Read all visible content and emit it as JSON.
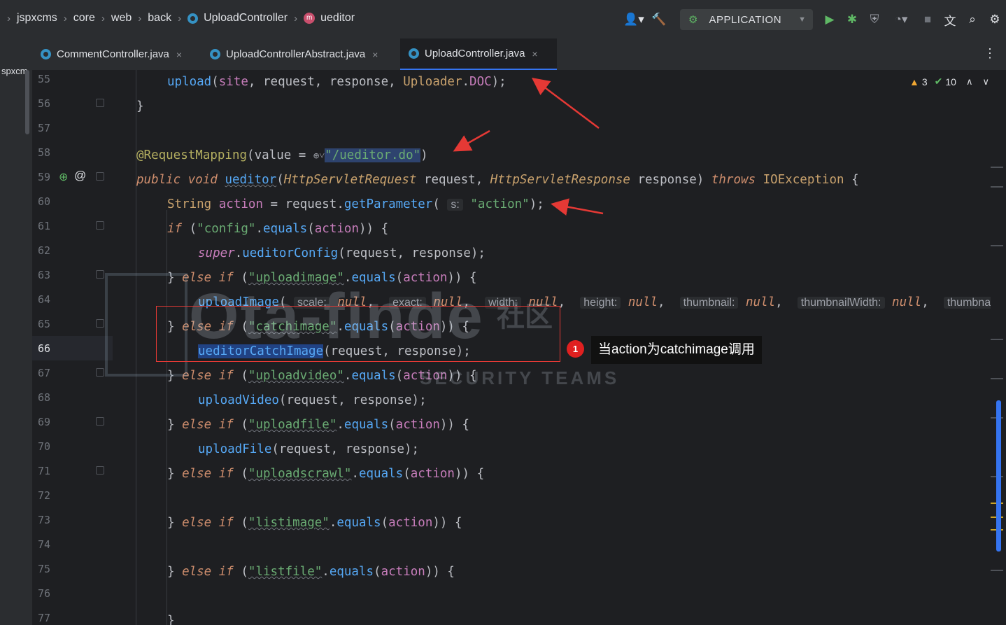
{
  "breadcrumbs": [
    "jspxcms",
    "core",
    "web",
    "back",
    "UploadController",
    "ueditor"
  ],
  "toolbar": {
    "run_config": "APPLICATION"
  },
  "tabs": [
    {
      "label": "CommentController.java",
      "active": false
    },
    {
      "label": "UploadControllerAbstract.java",
      "active": false
    },
    {
      "label": "UploadController.java",
      "active": true
    }
  ],
  "project_label": "spxcm",
  "inspections": {
    "warnings": "3",
    "ok": "10"
  },
  "line_numbers": [
    "55",
    "56",
    "57",
    "58",
    "59",
    "60",
    "61",
    "62",
    "63",
    "64",
    "65",
    "66",
    "67",
    "68",
    "69",
    "70",
    "71",
    "72",
    "73",
    "74",
    "75",
    "76",
    "77"
  ],
  "current_line": "66",
  "code": {
    "l55": {
      "a": "upload",
      "b": "(",
      "c": "site",
      "d": ", request, response, ",
      "e": "Uploader",
      "f": ".",
      "g": "DOC",
      "h": ");"
    },
    "l56": {
      "a": "}"
    },
    "l58": {
      "a": "@RequestMapping",
      "b": "(value = ",
      "c": "\"/ueditor.do\"",
      "d": ")"
    },
    "l59": {
      "a": "public void ",
      "b": "ueditor",
      "c": "(",
      "d": "HttpServletRequest",
      "e": " request, ",
      "f": "HttpServletResponse",
      "g": " response) ",
      "h": "throws ",
      "i": "IOException",
      "j": " {"
    },
    "l60": {
      "a": "String ",
      "b": "action",
      "c": " = request.",
      "d": "getParameter",
      "e": "( ",
      "hint": "s:",
      "f": " \"action\"",
      "g": ");"
    },
    "l61": {
      "a": "if",
      "b": " (",
      "c": "\"config\"",
      "d": ".",
      "e": "equals",
      "f": "(",
      "g": "action",
      "h": ")) {"
    },
    "l62": {
      "a": "super",
      "b": ".",
      "c": "ueditorConfig",
      "d": "(request, response);"
    },
    "l63": {
      "a": "} ",
      "b": "else if",
      "c": " (",
      "d": "\"uploadimage\"",
      "e": ".",
      "f": "equals",
      "g": "(",
      "h": "action",
      "i": ")) {"
    },
    "l64": {
      "a": "uploadImage",
      "b": "( ",
      "h1": "scale:",
      "v1": "null",
      "h2": "exact:",
      "v2": "null",
      "h3": "width:",
      "v3": "null",
      "h4": "height:",
      "v4": "null",
      "h5": "thumbnail:",
      "v5": "null",
      "h6": "thumbnailWidth:",
      "v6": "null",
      "h7": "thumbnailHeig",
      "c": ","
    },
    "l65": {
      "a": "} ",
      "b": "else if",
      "c": " (",
      "d": "\"catchimage\"",
      "e": ".",
      "f": "equals",
      "g": "(",
      "h": "action",
      "i": ")) {"
    },
    "l66": {
      "a": "ueditorCatchImage",
      "b": "(request, response);"
    },
    "l67": {
      "a": "} ",
      "b": "else if",
      "c": " (",
      "d": "\"uploadvideo\"",
      "e": ".",
      "f": "equals",
      "g": "(",
      "h": "action",
      "i": ")) {"
    },
    "l68": {
      "a": "uploadVideo",
      "b": "(request, response);"
    },
    "l69": {
      "a": "} ",
      "b": "else if",
      "c": " (",
      "d": "\"uploadfile\"",
      "e": ".",
      "f": "equals",
      "g": "(",
      "h": "action",
      "i": ")) {"
    },
    "l70": {
      "a": "uploadFile",
      "b": "(request, response);"
    },
    "l71": {
      "a": "} ",
      "b": "else if",
      "c": " (",
      "d": "\"uploadscrawl\"",
      "e": ".",
      "f": "equals",
      "g": "(",
      "h": "action",
      "i": ")) {"
    },
    "l73": {
      "a": "} ",
      "b": "else if",
      "c": " (",
      "d": "\"listimage\"",
      "e": ".",
      "f": "equals",
      "g": "(",
      "h": "action",
      "i": ")) {"
    },
    "l75": {
      "a": "} ",
      "b": "else if",
      "c": " (",
      "d": "\"listfile\"",
      "e": ".",
      "f": "equals",
      "g": "(",
      "h": "action",
      "i": ")) {"
    },
    "l77": {
      "a": "}"
    }
  },
  "annotation": {
    "badge": "1",
    "text": "当action为catchimage调用"
  },
  "watermark": {
    "big": "Ota-finde",
    "small": "SECURITY TEAMS",
    "cn": "社区"
  }
}
